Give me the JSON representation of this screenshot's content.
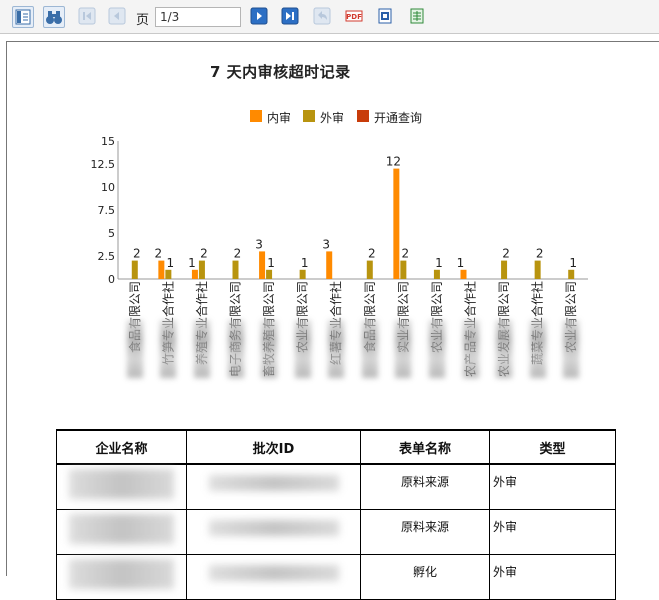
{
  "toolbar": {
    "buttons": [
      {
        "name": "toggle-sidebar-icon",
        "color": "#3a6ea8"
      },
      {
        "name": "binoculars-icon",
        "color": "#3a6ea8"
      },
      {
        "name": "first-page-icon",
        "color": "#b8c8dc"
      },
      {
        "name": "prev-page-icon",
        "color": "#b8c8dc"
      },
      {
        "name": "next-page-icon",
        "color": "#2c6fc4"
      },
      {
        "name": "last-page-icon",
        "color": "#2c6fc4"
      },
      {
        "name": "back-icon",
        "color": "#b8c8dc"
      },
      {
        "name": "export-pdf-icon",
        "color": "#d23a2e"
      },
      {
        "name": "export-word-icon",
        "color": "#2b5fa8"
      },
      {
        "name": "export-excel-icon",
        "color": "#2f8a3a"
      }
    ],
    "page_label": "页",
    "page_value": "1/3",
    "pdf_badge": "PDF"
  },
  "report": {
    "title": "7 天内审核超时记录"
  },
  "chart_data": {
    "type": "bar",
    "title": "7 天内审核超时记录",
    "legend_position": "top",
    "ylim": [
      0,
      15
    ],
    "yticks": [
      "0",
      "2.5",
      "5",
      "7.5",
      "10",
      "12.5",
      "15"
    ],
    "categories": [
      "食品有限公司",
      "竹笋专业合作社",
      "养殖专业合作社",
      "电子商务有限公司",
      "畜牧养殖有限公司",
      "农业有限公司",
      "红薯专业合作社",
      "食品有限公司",
      "实业有限公司",
      "农业有限公司",
      "农产品专业合作社",
      "农业发展有限公司",
      "蔬菜专业合作社",
      "农业有限公司"
    ],
    "series": [
      {
        "name": "内审",
        "color": "#ff8a00",
        "values": [
          0,
          2,
          1,
          0,
          3,
          0,
          3,
          0,
          12,
          0,
          1,
          0,
          0,
          0
        ]
      },
      {
        "name": "外审",
        "color": "#b8940f",
        "values": [
          2,
          1,
          2,
          2,
          1,
          1,
          0,
          2,
          2,
          1,
          0,
          2,
          2,
          1
        ]
      },
      {
        "name": "开通查询",
        "color": "#c83c0a",
        "values": [
          0,
          0,
          0,
          0,
          0,
          0,
          0,
          0,
          0,
          0,
          0,
          0,
          0,
          0
        ]
      }
    ]
  },
  "table": {
    "headers": [
      "企业名称",
      "批次ID",
      "表单名称",
      "类型"
    ],
    "rows": [
      {
        "form": "原料来源",
        "type": "外审"
      },
      {
        "form": "原料来源",
        "type": "外审"
      },
      {
        "form": "孵化",
        "type": "外审"
      }
    ]
  }
}
